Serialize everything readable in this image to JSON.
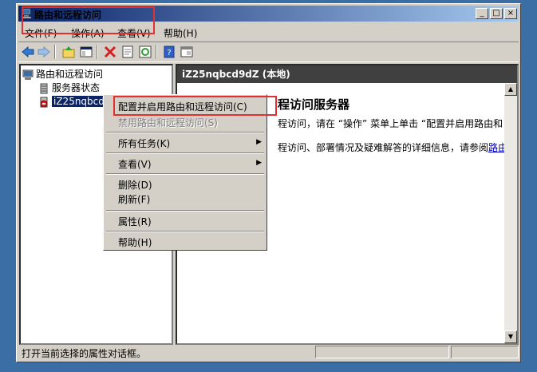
{
  "window": {
    "title": "路由和远程访问",
    "controls": [
      "_",
      "□",
      "×"
    ]
  },
  "menu": [
    "文件(F)",
    "操作(A)",
    "查看(V)",
    "帮助(H)"
  ],
  "toolbar": {
    "icons": [
      "back-icon",
      "forward-icon",
      "up-icon",
      "show-hide-tree-icon",
      "delete-icon",
      "properties-icon",
      "refresh-icon",
      "help-icon",
      "console-icon"
    ]
  },
  "tree": {
    "root": "路由和远程访问",
    "status": "服务器状态",
    "server": "iZ25nqbcd9dZ (本地)"
  },
  "right": {
    "header": "iZ25nqbcd9dZ (本地)",
    "title": "程访问服务器",
    "line1": "程访问，请在 “操作” 菜单上单击 “配置并启用路由和",
    "line2": "程访问、部署情况及疑难解答的详细信息，请参阅",
    "link": "路由"
  },
  "context_menu": {
    "items": [
      {
        "label": "配置并启用路由和远程访问(C)",
        "disabled": false,
        "submenu": false
      },
      {
        "label": "禁用路由和远程访问(S)",
        "disabled": true,
        "submenu": false
      },
      {
        "label": "所有任务(K)",
        "disabled": false,
        "submenu": true
      },
      {
        "label": "查看(V)",
        "disabled": false,
        "submenu": true
      },
      {
        "label": "删除(D)",
        "disabled": false,
        "submenu": false
      },
      {
        "label": "刷新(F)",
        "disabled": false,
        "submenu": false
      },
      {
        "label": "属性(R)",
        "disabled": false,
        "submenu": false
      },
      {
        "label": "帮助(H)",
        "disabled": false,
        "submenu": false
      }
    ]
  },
  "statusbar": {
    "text": "打开当前选择的属性对话框。"
  },
  "colors": {
    "desktop": "#3a6ea5",
    "title_start": "#0a246a",
    "title_end": "#a6caf0",
    "selection": "#0a246a",
    "highlight_box": "#e03030",
    "face": "#d4d0c8"
  }
}
